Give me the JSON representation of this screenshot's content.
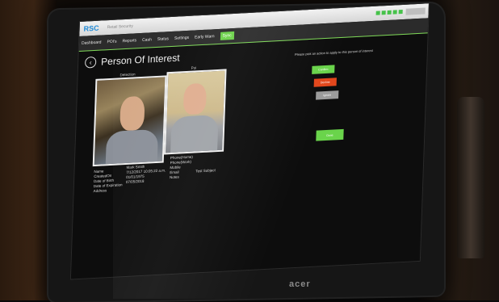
{
  "monitor": {
    "brand": "acer"
  },
  "app": {
    "logo": "RSC",
    "subtitle": "Retail Security"
  },
  "nav": {
    "items": [
      "Dashboard",
      "POI's",
      "Reports",
      "Cash",
      "Status",
      "Settings",
      "Early Warn",
      "Sync"
    ],
    "active_index": 7
  },
  "page": {
    "title": "Person Of Interest",
    "instruction": "Please pick an action to apply to this person of interest",
    "detection_label": "Detection",
    "poi_label": "Poi"
  },
  "person": {
    "left_labels": [
      "Name",
      "CreatedOn",
      "Date of Birth",
      "Date of Expiration",
      "Address"
    ],
    "left_values": [
      "Mark Smith",
      "7/12/2017 10:05:22 a.m.",
      "01/01/1975",
      "07/05/2018",
      ""
    ],
    "right_labels": [
      "Phone(Home)",
      "Phone(Work)",
      "Mobile",
      "Email",
      "Notes"
    ],
    "right_values": [
      "",
      "",
      "",
      "",
      "Test Subject"
    ]
  },
  "actions": [
    {
      "label": "Confirm",
      "color": "#6ad44b"
    },
    {
      "label": "Decline",
      "color": "#e2471c"
    },
    {
      "label": "Ignore",
      "color": "#9b9b9b"
    },
    {
      "label": "Done",
      "color": "#6ad44b"
    }
  ],
  "colors": {
    "accent": "#6cd14a",
    "status_dots": "#46c24a"
  }
}
